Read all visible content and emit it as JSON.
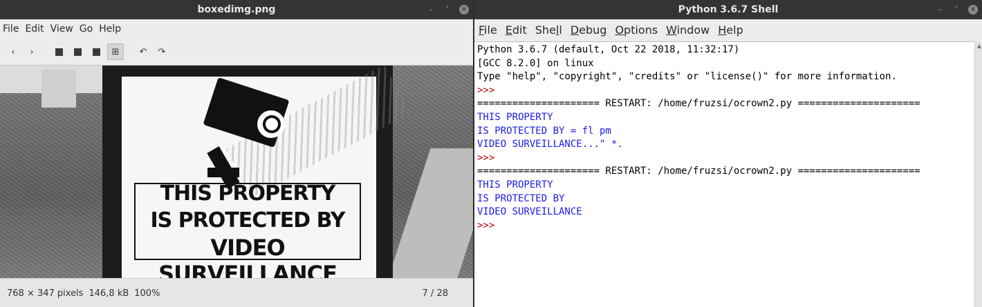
{
  "image_viewer": {
    "title": "boxedimg.png",
    "menu": [
      "File",
      "Edit",
      "View",
      "Go",
      "Help"
    ],
    "toolbar_icons": [
      "prev-arrow-icon",
      "next-arrow-icon",
      "zoom-out-icon",
      "zoom-in-icon",
      "normal-size-icon",
      "best-fit-icon",
      "rotate-left-icon",
      "rotate-right-icon"
    ],
    "sign": {
      "lines": [
        "THIS PROPERTY",
        "IS PROTECTED BY",
        "VIDEO SURVEILLANCE"
      ]
    },
    "status": {
      "dimensions": "768 × 347 pixels",
      "size": "146,8 kB",
      "zoom": "100%",
      "position": "7 / 28"
    }
  },
  "shell": {
    "title": "Python 3.6.7 Shell",
    "menu": [
      {
        "label": "File",
        "ul": "F",
        "rest": "ile"
      },
      {
        "label": "Edit",
        "ul": "E",
        "rest": "dit"
      },
      {
        "label": "Shell",
        "pre": "She",
        "ul": "l",
        "rest": "l"
      },
      {
        "label": "Debug",
        "ul": "D",
        "rest": "ebug"
      },
      {
        "label": "Options",
        "ul": "O",
        "rest": "ptions"
      },
      {
        "label": "Window",
        "ul": "W",
        "rest": "indow"
      },
      {
        "label": "Help",
        "ul": "H",
        "rest": "elp"
      }
    ],
    "lines": [
      {
        "text": "Python 3.6.7 (default, Oct 22 2018, 11:32:17)",
        "style": "plain"
      },
      {
        "text": "[GCC 8.2.0] on linux",
        "style": "plain"
      },
      {
        "text": "Type \"help\", \"copyright\", \"credits\" or \"license()\" for more information.",
        "style": "plain"
      },
      {
        "text": ">>> ",
        "style": "prompt"
      },
      {
        "text": "===================== RESTART: /home/fruzsi/ocrown2.py =====================",
        "style": "plain"
      },
      {
        "text": "THIS PROPERTY",
        "style": "blue"
      },
      {
        "text": "IS PROTECTED BY = fl pm",
        "style": "blue"
      },
      {
        "text": "VIDEO SURVEILLANCE...\" *.",
        "style": "blue"
      },
      {
        "text": ">>> ",
        "style": "prompt"
      },
      {
        "text": "===================== RESTART: /home/fruzsi/ocrown2.py =====================",
        "style": "plain"
      },
      {
        "text": "THIS PROPERTY",
        "style": "blue"
      },
      {
        "text": "IS PROTECTED BY",
        "style": "blue"
      },
      {
        "text": "VIDEO SURVEILLANCE",
        "style": "blue"
      },
      {
        "text": ">>> ",
        "style": "prompt"
      }
    ]
  }
}
